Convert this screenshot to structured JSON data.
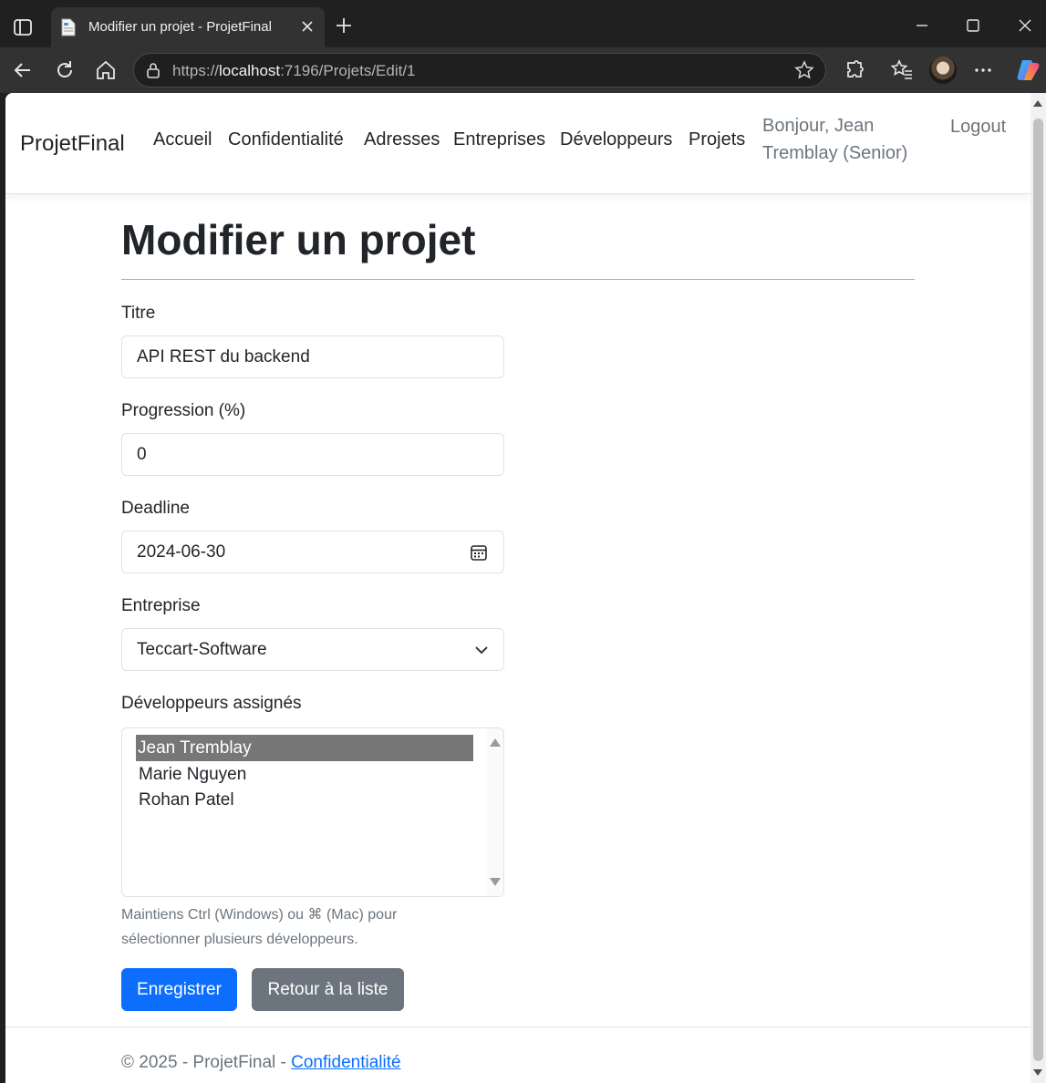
{
  "browser": {
    "tab_title": "Modifier un projet - ProjetFinal",
    "url_prefix": "https://",
    "url_host": "localhost",
    "url_path": ":7196/Projets/Edit/1"
  },
  "navbar": {
    "brand": "ProjetFinal",
    "links": [
      "Accueil",
      "Confidentialité",
      "Adresses",
      "Entreprises",
      "Développeurs",
      "Projets"
    ],
    "greeting": "Bonjour, Jean Tremblay (Senior)",
    "logout": "Logout"
  },
  "page": {
    "title": "Modifier un projet"
  },
  "form": {
    "titre": {
      "label": "Titre",
      "value": "API REST du backend"
    },
    "progression": {
      "label": "Progression (%)",
      "value": "0"
    },
    "deadline": {
      "label": "Deadline",
      "value": "2024-06-30"
    },
    "entreprise": {
      "label": "Entreprise",
      "value": "Teccart-Software"
    },
    "developpeurs": {
      "label": "Développeurs assignés",
      "options": [
        "Jean Tremblay",
        "Marie Nguyen",
        "Rohan Patel"
      ],
      "selected": "Jean Tremblay",
      "help": "Maintiens Ctrl (Windows) ou ⌘ (Mac) pour sélectionner plusieurs développeurs."
    },
    "save_label": "Enregistrer",
    "back_label": "Retour à la liste"
  },
  "footer": {
    "text": "© 2025 - ProjetFinal - ",
    "link": "Confidentialité"
  },
  "colors": {
    "primary": "#0d6efd",
    "secondary": "#6c757d",
    "selected_option": "#777777"
  }
}
